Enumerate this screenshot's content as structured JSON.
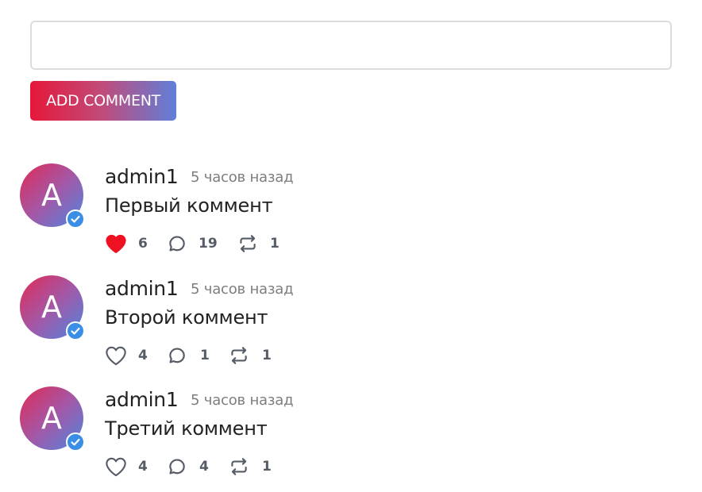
{
  "form": {
    "input_value": "",
    "input_placeholder": "",
    "button_label": "ADD COMMENT"
  },
  "colors": {
    "button_gradient": [
      "#e5173a",
      "#5f7fd9"
    ],
    "liked_heart": "#ee1122",
    "icon": "#555c66",
    "verified_badge": "#3a8ee6"
  },
  "icons": {
    "like": "heart-icon",
    "reply": "speech-bubble-icon",
    "repost": "repost-arrows-icon",
    "verified": "check-badge-icon"
  },
  "comments": [
    {
      "avatar_letter": "A",
      "author": "admin1",
      "time": "5 часов назад",
      "text": "Первый коммент",
      "liked": true,
      "likes": "6",
      "replies": "19",
      "reposts": "1"
    },
    {
      "avatar_letter": "A",
      "author": "admin1",
      "time": "5 часов назад",
      "text": "Второй коммент",
      "liked": false,
      "likes": "4",
      "replies": "1",
      "reposts": "1"
    },
    {
      "avatar_letter": "A",
      "author": "admin1",
      "time": "5 часов назад",
      "text": "Третий коммент",
      "liked": false,
      "likes": "4",
      "replies": "4",
      "reposts": "1"
    }
  ]
}
